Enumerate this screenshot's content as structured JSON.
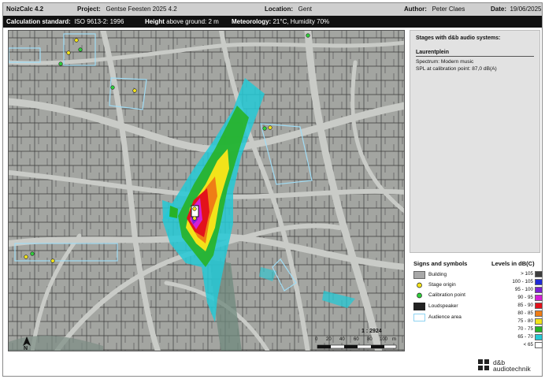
{
  "header": {
    "app": "NoizCalc 4.2",
    "project_label": "Project:",
    "project_value": "Gentse Feesten 2025 4.2",
    "location_label": "Location:",
    "location_value": "Gent",
    "author_label": "Author:",
    "author_value": "Peter Claes",
    "date_label": "Date:",
    "date_value": "19/06/2025"
  },
  "subheader": {
    "standard_label": "Calculation standard:",
    "standard_value": "ISO 9613-2: 1996",
    "height_label": "Height",
    "height_value": "above ground: 2 m",
    "meteo_label": "Meteorology:",
    "meteo_value": "21°C, Humidity 70%"
  },
  "stages": {
    "title": "Stages with d&b audio systems:",
    "name": "Laurentplein",
    "spectrum": "Spectrum:  Modern music",
    "spl": "SPL at calibration point:  87,0 dB(A)"
  },
  "symbols": {
    "title": "Signs and symbols",
    "items": [
      {
        "label": "Building",
        "icon": "building-swatch"
      },
      {
        "label": "Stage origin",
        "icon": "yellow-dot"
      },
      {
        "label": "Calibration point",
        "icon": "green-dot"
      },
      {
        "label": "Loudspeaker",
        "icon": "black-bar"
      },
      {
        "label": "Audience area",
        "icon": "light-blue-outline"
      }
    ]
  },
  "levels": {
    "title": "Levels in dB(C)",
    "items": [
      {
        "label": "> 105",
        "color": "#3d3d3d"
      },
      {
        "label": "100 - 105",
        "color": "#1f2bd6"
      },
      {
        "label": "95 - 100",
        "color": "#7a21d1"
      },
      {
        "label": "90 - 95",
        "color": "#d41fd6"
      },
      {
        "label": "85 - 90",
        "color": "#e3121b"
      },
      {
        "label": "80 - 85",
        "color": "#ef7d16"
      },
      {
        "label": "75 - 80",
        "color": "#f2e31a"
      },
      {
        "label": "70 - 75",
        "color": "#27b227"
      },
      {
        "label": "65 - 70",
        "color": "#24c9d6"
      },
      {
        "label": "< 65",
        "color": "#ffffff"
      }
    ]
  },
  "scale": {
    "ratio": "1 : 2924",
    "ticks": [
      "0",
      "20",
      "40",
      "60",
      "80",
      "100",
      "m"
    ]
  },
  "north": "N",
  "logo": {
    "line1": "d&b",
    "line2": "audiotechnik"
  }
}
